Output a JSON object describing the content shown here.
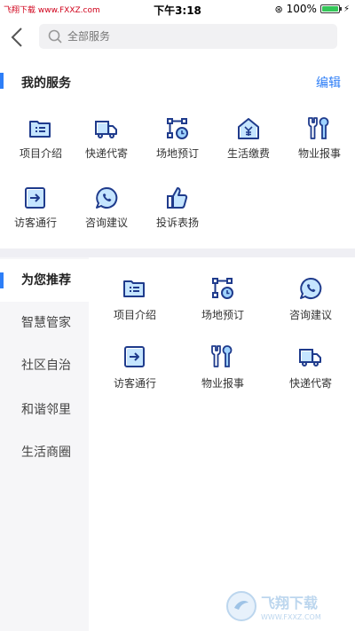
{
  "status_bar": {
    "carrier": "飞翔下载 www.FXXZ.com",
    "time": "下午3:18",
    "battery": "100%"
  },
  "search": {
    "placeholder": "全部服务"
  },
  "my_services": {
    "title": "我的服务",
    "edit_label": "编辑",
    "items": [
      {
        "label": "项目介绍",
        "icon": "folder-list-icon"
      },
      {
        "label": "快递代寄",
        "icon": "delivery-truck-icon"
      },
      {
        "label": "场地预订",
        "icon": "venue-clock-icon"
      },
      {
        "label": "生活缴费",
        "icon": "house-yen-icon"
      },
      {
        "label": "物业报事",
        "icon": "tools-icon"
      },
      {
        "label": "访客通行",
        "icon": "visitor-door-icon"
      },
      {
        "label": "咨询建议",
        "icon": "chat-phone-icon"
      },
      {
        "label": "投诉表扬",
        "icon": "thumbs-up-icon"
      }
    ]
  },
  "sidebar": {
    "items": [
      {
        "label": "为您推荐"
      },
      {
        "label": "智慧管家"
      },
      {
        "label": "社区自治"
      },
      {
        "label": "和谐邻里"
      },
      {
        "label": "生活商圈"
      }
    ]
  },
  "recommend": {
    "items": [
      {
        "label": "项目介绍",
        "icon": "folder-list-icon"
      },
      {
        "label": "场地预订",
        "icon": "venue-clock-icon"
      },
      {
        "label": "咨询建议",
        "icon": "chat-phone-icon"
      },
      {
        "label": "访客通行",
        "icon": "visitor-door-icon"
      },
      {
        "label": "物业报事",
        "icon": "tools-icon"
      },
      {
        "label": "快递代寄",
        "icon": "delivery-truck-icon"
      }
    ]
  },
  "watermark": {
    "text": "飞翔下载",
    "url": "WWW.FXXZ.COM"
  },
  "colors": {
    "accent": "#2d7ef7",
    "icon_dark": "#1f3b8c",
    "icon_light": "#9fd3ff"
  }
}
